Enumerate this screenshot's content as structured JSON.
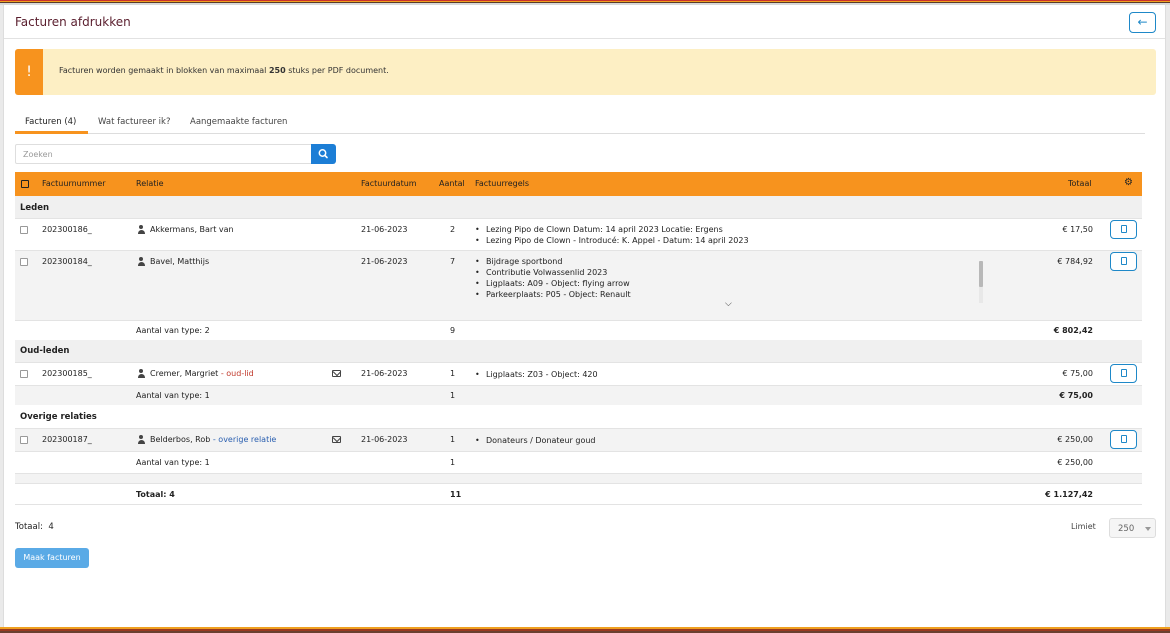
{
  "header": {
    "title": "Facturen afdrukken",
    "back_icon": "←"
  },
  "alert": {
    "icon": "!",
    "before": "Facturen worden gemaakt in blokken van maximaal ",
    "count": "250",
    "after": " stuks per PDF document."
  },
  "tabs": [
    {
      "label": "Facturen (4)"
    },
    {
      "label": "Wat factureer ik?"
    },
    {
      "label": "Aangemaakte facturen"
    }
  ],
  "search": {
    "placeholder": "Zoeken"
  },
  "columns": {
    "number": "Factuurnummer",
    "relation": "Relatie",
    "date": "Factuurdatum",
    "count": "Aantal",
    "lines": "Factuurregels",
    "total": "Totaal"
  },
  "groups": [
    {
      "name": "Leden",
      "rows": [
        {
          "number": "202300186_",
          "relation": "Akkermans, Bart van",
          "tag": "",
          "date": "21-06-2023",
          "count": "2",
          "lines": [
            "Lezing Pipo de Clown Datum: 14 april 2023 Locatie: Ergens",
            "Lezing Pipo de Clown - Introducé: K. Appel - Datum: 14 april 2023"
          ],
          "total": "€ 17,50"
        },
        {
          "number": "202300184_",
          "relation": "Bavel, Matthijs",
          "tag": "",
          "date": "21-06-2023",
          "count": "7",
          "lines": [
            "Bijdrage sportbond",
            "Contributie Volwassenlid 2023",
            "Ligplaats: A09 - Object: flying arrow",
            "Parkeerplaats: P05 - Object: Renault"
          ],
          "total": "€ 784,92"
        }
      ],
      "subtotal": {
        "label": "Aantal van type: 2",
        "count": "9",
        "total": "€ 802,42"
      }
    },
    {
      "name": "Oud-leden",
      "rows": [
        {
          "number": "202300185_",
          "relation": "Cremer, Margriet",
          "tag": "- oud-lid",
          "date": "21-06-2023",
          "count": "1",
          "lines": [
            "Ligplaats: Z03 - Object: 420"
          ],
          "total": "€ 75,00"
        }
      ],
      "subtotal": {
        "label": "Aantal van type: 1",
        "count": "1",
        "total": "€ 75,00"
      }
    },
    {
      "name": "Overige relaties",
      "rows": [
        {
          "number": "202300187_",
          "relation": "Belderbos, Rob",
          "tag": "- overige relatie",
          "date": "21-06-2023",
          "count": "1",
          "lines": [
            "Donateurs / Donateur goud"
          ],
          "total": "€ 250,00"
        }
      ],
      "subtotal": {
        "label": "Aantal van type: 1",
        "count": "1",
        "total": "€ 250,00"
      }
    }
  ],
  "grand_total": {
    "label": "Totaal: 4",
    "count": "11",
    "total": "€ 1.127,42"
  },
  "footer": {
    "total_label": "Totaal:",
    "total_value": "4",
    "limiet_label": "Limiet",
    "limiet_value": "250",
    "make_button": "Maak facturen"
  },
  "colors": {
    "accent": "#f7931e",
    "primary": "#1c7ed6",
    "alert_bg": "#fdefc4",
    "oud_lid": "#c0392b",
    "overige": "#2a5fb0"
  }
}
